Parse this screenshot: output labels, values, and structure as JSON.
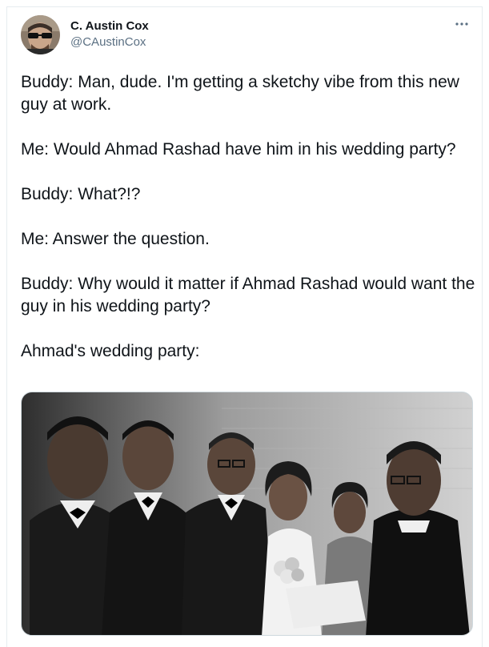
{
  "tweet": {
    "author_name": "C. Austin Cox",
    "author_handle": "@CAustinCox",
    "lines": [
      "Buddy: Man, dude. I'm getting a sketchy vibe from this new guy at work.",
      "Me: Would Ahmad Rashad have him in his wedding party?",
      "Buddy: What?!?",
      "Me: Answer the question.",
      "Buddy: Why would it matter if Ahmad Rashad would want the guy in his wedding party?",
      "Ahmad's wedding party:"
    ]
  },
  "icons": {
    "more": "more-horizontal-icon"
  },
  "colors": {
    "text": "#0f1419",
    "secondary": "#5b7083",
    "border": "#e6ecf0"
  }
}
